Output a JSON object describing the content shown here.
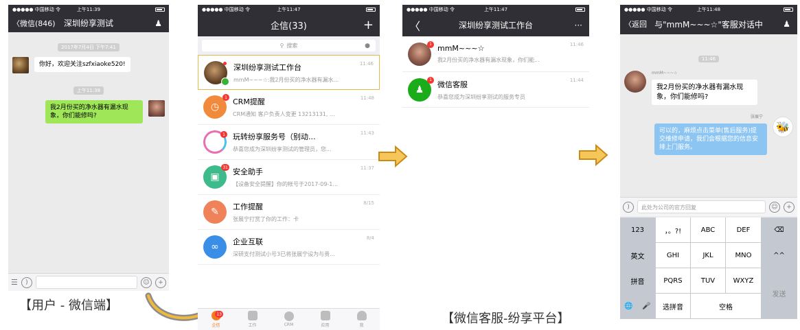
{
  "phone1": {
    "status": {
      "carrier": "●●●●● 中国移动 令",
      "time": "上午11:39"
    },
    "nav": {
      "back": "〈微信(846)",
      "title": "深圳纷享测试",
      "user_icon": "user-icon"
    },
    "time1": "2017年7月4日 下午7:41",
    "msg_in": "你好，欢迎关注szfxiaoke520!",
    "time2": "上午11:38",
    "msg_out": "我2月份买的净水器有漏水现象，你们能修吗?",
    "caption": "【用户 - 微信端】"
  },
  "phone2": {
    "status": {
      "carrier": "●●●●● 中国移动 令",
      "time": "上午11:47"
    },
    "nav": {
      "title": "企信(33)",
      "plus": "+"
    },
    "search_placeholder": "搜索",
    "conversations": [
      {
        "name": "深圳纷享测试工作台",
        "sub": "mmM~~~☆:我2月份买的净水器有漏水...",
        "time": "11:46",
        "color": "#7a5a3a"
      },
      {
        "name": "CRM提醒",
        "sub": "CRM通知 客户负责人变更 13213131, ...",
        "time": "11:48",
        "color": "#f28a3c",
        "badge": "1"
      },
      {
        "name": "玩转纷享服务号（别动...",
        "sub": "恭喜您成为深圳纷享测试的管理员，您...",
        "time": "11:43",
        "color": "#ffffff",
        "badge": "1"
      },
      {
        "name": "安全助手",
        "sub": "【设备安全提醒】你的帐号于2017-09-1...",
        "time": "11:37",
        "color": "#3dbb8c",
        "badge": "31"
      },
      {
        "name": "工作提醒",
        "sub": "张展宁打赏了你的工作：卡",
        "time": "8/15",
        "color": "#f0825a"
      },
      {
        "name": "企业互联",
        "sub": "深研支付测试小号3已将张展宁设为与贵...",
        "time": "8/4",
        "color": "#3a8ee6"
      }
    ],
    "tabs": [
      "企信",
      "工作",
      "CRM",
      "应用",
      "我"
    ],
    "tab_badge": "13"
  },
  "phone3": {
    "status": {
      "carrier": "●●●●● 中国移动 令",
      "time": "上午11:47"
    },
    "nav": {
      "back": "〈",
      "title": "深圳纷享测试工作台",
      "more": "···"
    },
    "conversations": [
      {
        "name": "mmM~~~☆",
        "sub": "我2月份买的净水器有漏水现象，你们能...",
        "time": "11:46",
        "badge": "1"
      },
      {
        "name": "微信客服",
        "sub": "恭喜您成为深圳纷享测试的服务专员",
        "time": "11:44",
        "badge": "1"
      }
    ],
    "caption": "【微信客服-纷享平台】"
  },
  "phone4": {
    "status": {
      "carrier": "●●●●● 中国移动 令",
      "time": "上午11:48"
    },
    "nav": {
      "back": "〈返回",
      "title": "与\"mmM~~~☆\"客服对话中"
    },
    "time1": "11:46",
    "sender_in": "mmM~~~☆",
    "msg_in": "我2月份买的净水器有漏水现象，你们能修吗?",
    "sender_out": "张展宁",
    "msg_out": "可以的，麻烦点击菜单(售后服务)提交维修申请，我们会根据您的信息安排上门服务。",
    "input_placeholder": "此处为公司的官方回复",
    "keys": {
      "k123": "123",
      "punct": "，。?!",
      "abc": "ABC",
      "def": "DEF",
      "del": "⌫",
      "en": "英文",
      "ghi": "GHI",
      "jkl": "JKL",
      "mno": "MNO",
      "face": "^^",
      "pinyin": "拼音",
      "pqrs": "PQRS",
      "tuv": "TUV",
      "wxyz": "WXYZ",
      "send": "发送",
      "globe": "🌐",
      "mic": "🎤",
      "select": "选拼音",
      "space": "空格"
    }
  }
}
